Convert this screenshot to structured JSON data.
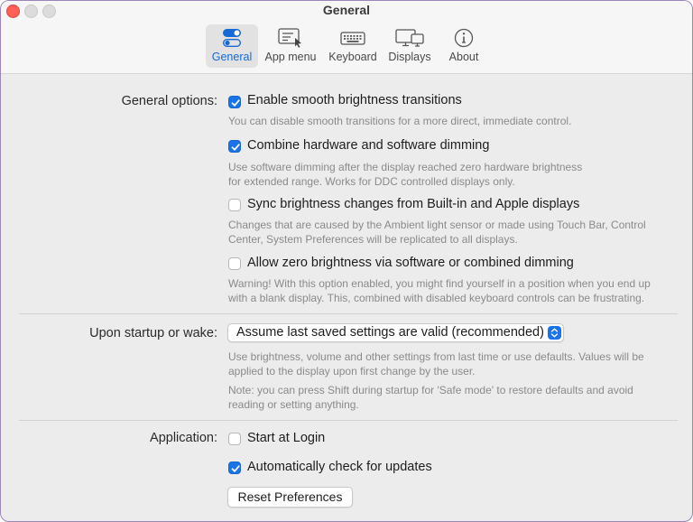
{
  "window": {
    "title": "General"
  },
  "toolbar": {
    "tabs": [
      {
        "label": "General",
        "icon": "toggles-icon",
        "active": true
      },
      {
        "label": "App menu",
        "icon": "app-menu-icon",
        "active": false
      },
      {
        "label": "Keyboard",
        "icon": "keyboard-icon",
        "active": false
      },
      {
        "label": "Displays",
        "icon": "displays-icon",
        "active": false
      },
      {
        "label": "About",
        "icon": "info-icon",
        "active": false
      }
    ]
  },
  "general_options": {
    "label": "General options:",
    "options": [
      {
        "label": "Enable smooth brightness transitions",
        "checked": true,
        "description": "You can disable smooth transitions for a more direct, immediate control."
      },
      {
        "label": "Combine hardware and software dimming",
        "checked": true,
        "description_lines": [
          "Use software dimming after the display reached zero hardware brightness",
          "for extended range. Works for DDC controlled displays only."
        ]
      },
      {
        "label": "Sync brightness changes from Built-in and Apple displays",
        "checked": false,
        "description_lines": [
          "Changes that are caused by the Ambient light sensor or made using Touch Bar, Control",
          "Center, System Preferences will be replicated to all displays."
        ]
      },
      {
        "label": "Allow zero brightness via software or combined dimming",
        "checked": false,
        "description_lines": [
          "Warning! With this option enabled, you might find yourself in a position when you end up",
          "with a blank display. This, combined with disabled keyboard controls can be frustrating."
        ]
      }
    ]
  },
  "startup": {
    "label": "Upon startup or wake:",
    "selected": "Assume last saved settings are valid (recommended)",
    "description_lines": [
      "Use brightness, volume and other settings from last time or use defaults. Values will be",
      "applied to the display upon first change by the user."
    ],
    "note_lines": [
      "Note: you can press Shift during startup for 'Safe mode' to restore defaults and avoid",
      "reading or setting anything."
    ]
  },
  "application": {
    "label": "Application:",
    "options": [
      {
        "label": "Start at Login",
        "checked": false
      },
      {
        "label": "Automatically check for updates",
        "checked": true
      }
    ],
    "reset_button": "Reset Preferences"
  },
  "colors": {
    "accent": "#1a73e8",
    "close": "#fe5f57"
  }
}
